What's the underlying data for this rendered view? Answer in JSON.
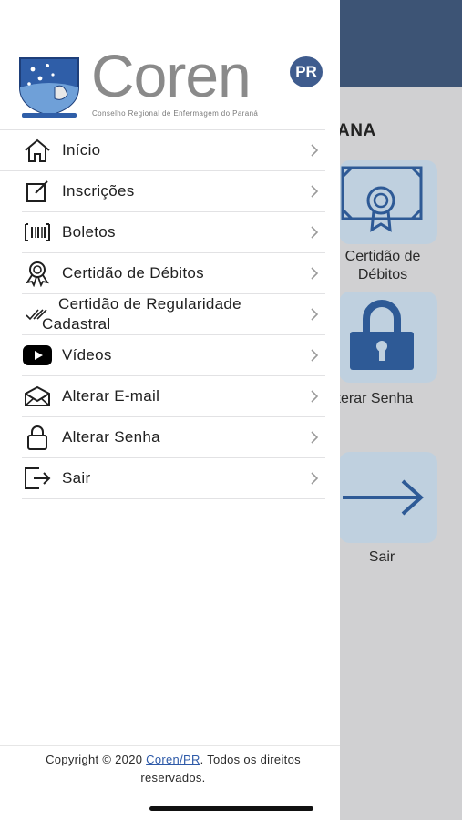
{
  "background": {
    "partial_title": "ANA",
    "tiles": [
      {
        "label_line1": "Certidão de",
        "label_line2": "Débitos",
        "icon": "certificate-icon"
      },
      {
        "label_line1": "lterar Senha",
        "icon": "lock-icon"
      },
      {
        "label_line1": "Sair",
        "icon": "arrow-right-icon"
      }
    ]
  },
  "drawer": {
    "brand": {
      "name": "Coren",
      "badge": "PR",
      "subtitle": "Conselho Regional de Enfermagem do Paraná"
    },
    "menu": [
      {
        "label": "Início",
        "icon": "home-icon"
      },
      {
        "label": "Inscrições",
        "icon": "edit-icon"
      },
      {
        "label": "Boletos",
        "icon": "barcode-icon"
      },
      {
        "label": "Certidão de Débitos",
        "icon": "award-icon"
      },
      {
        "label_line1": "Certidão de Regularidade",
        "label_line2": "Cadastral",
        "icon": "double-check-icon"
      },
      {
        "label": "Vídeos",
        "icon": "youtube-icon"
      },
      {
        "label": "Alterar E-mail",
        "icon": "mail-icon"
      },
      {
        "label": "Alterar Senha",
        "icon": "lock-icon"
      },
      {
        "label": "Sair",
        "icon": "logout-icon"
      }
    ],
    "footer": {
      "prefix": "Copyright © 2020 ",
      "link": "Coren/PR",
      "suffix": ". Todos os direitos",
      "line2": "reservados."
    }
  },
  "colors": {
    "header_bg": "#3d5475",
    "tile_bg": "#bfd0df",
    "icon_blue": "#2e5a96",
    "badge_bg": "#3f5c8e"
  }
}
